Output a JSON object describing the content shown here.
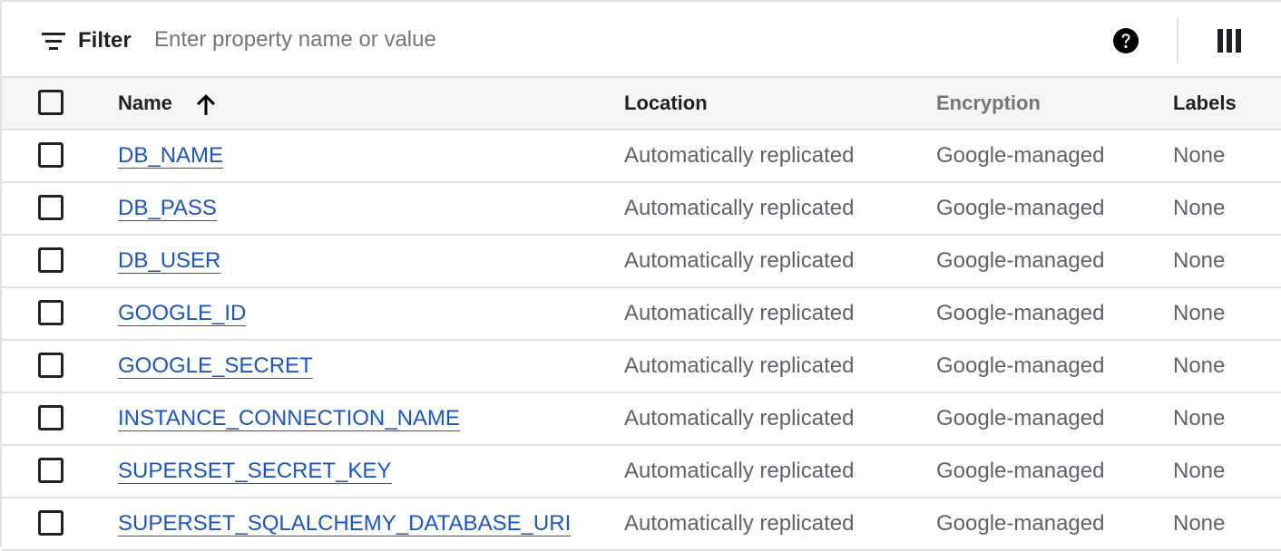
{
  "filter": {
    "label": "Filter",
    "placeholder": "Enter property name or value",
    "value": ""
  },
  "icons": {
    "filter": "filter-list-icon",
    "help": "help-icon",
    "columns": "column-display-icon",
    "sort": "arrow-upward-icon"
  },
  "colors": {
    "link": "#1a55c7",
    "header_bg": "#f5f5f5",
    "divider": "#e0e0e0"
  },
  "table": {
    "columns": {
      "name": "Name",
      "location": "Location",
      "encryption": "Encryption",
      "labels": "Labels"
    },
    "sort": {
      "column": "Name",
      "direction": "ascending"
    },
    "rows": [
      {
        "name": "DB_NAME",
        "location": "Automatically replicated",
        "encryption": "Google-managed",
        "labels": "None"
      },
      {
        "name": "DB_PASS",
        "location": "Automatically replicated",
        "encryption": "Google-managed",
        "labels": "None"
      },
      {
        "name": "DB_USER",
        "location": "Automatically replicated",
        "encryption": "Google-managed",
        "labels": "None"
      },
      {
        "name": "GOOGLE_ID",
        "location": "Automatically replicated",
        "encryption": "Google-managed",
        "labels": "None"
      },
      {
        "name": "GOOGLE_SECRET",
        "location": "Automatically replicated",
        "encryption": "Google-managed",
        "labels": "None"
      },
      {
        "name": "INSTANCE_CONNECTION_NAME",
        "location": "Automatically replicated",
        "encryption": "Google-managed",
        "labels": "None"
      },
      {
        "name": "SUPERSET_SECRET_KEY",
        "location": "Automatically replicated",
        "encryption": "Google-managed",
        "labels": "None"
      },
      {
        "name": "SUPERSET_SQLALCHEMY_DATABASE_URI",
        "location": "Automatically replicated",
        "encryption": "Google-managed",
        "labels": "None"
      }
    ]
  }
}
